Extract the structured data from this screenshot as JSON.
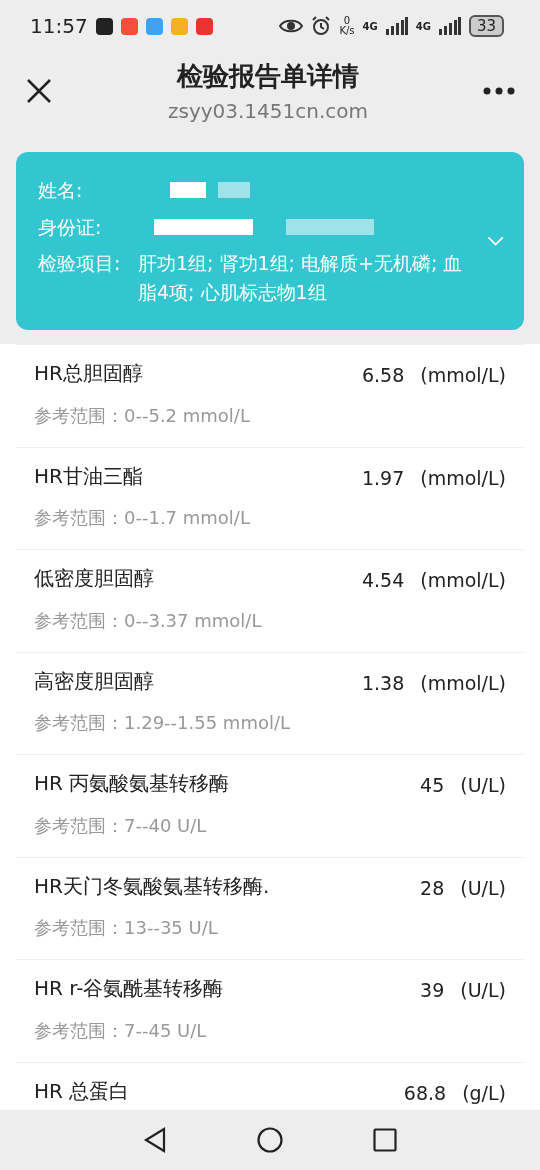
{
  "status_bar": {
    "time": "11:57",
    "net_speed_value": "0",
    "net_speed_unit": "K/s",
    "network_1": "4G",
    "network_2": "4G",
    "battery": "33"
  },
  "header": {
    "title": "检验报告单详情",
    "url": "zsyy03.1451cn.com"
  },
  "patient_card": {
    "expanded": false,
    "fields": [
      {
        "label": "姓名:",
        "kind": "redacted"
      },
      {
        "label": "身份证:",
        "kind": "redacted"
      },
      {
        "label": "检验项目:",
        "value": "肝功1组; 肾功1组; 电解质+无机磷; 血脂4项; 心肌标志物1组",
        "kind": "text"
      }
    ]
  },
  "results": [
    {
      "name": "HR总胆固醇",
      "value": "6.58",
      "unit": "(mmol/L)",
      "range": "参考范围：0--5.2 mmol/L"
    },
    {
      "name": "HR甘油三酯",
      "value": "1.97",
      "unit": "(mmol/L)",
      "range": "参考范围：0--1.7 mmol/L"
    },
    {
      "name": "低密度胆固醇",
      "value": "4.54",
      "unit": "(mmol/L)",
      "range": "参考范围：0--3.37 mmol/L"
    },
    {
      "name": "高密度胆固醇",
      "value": "1.38",
      "unit": "(mmol/L)",
      "range": "参考范围：1.29--1.55 mmol/L"
    },
    {
      "name": "HR 丙氨酸氨基转移酶",
      "value": "45",
      "unit": "(U/L)",
      "range": "参考范围：7--40 U/L"
    },
    {
      "name": "HR天门冬氨酸氨基转移酶.",
      "value": "28",
      "unit": "(U/L)",
      "range": "参考范围：13--35 U/L"
    },
    {
      "name": "HR r-谷氨酰基转移酶",
      "value": "39",
      "unit": "(U/L)",
      "range": "参考范围：7--45 U/L"
    },
    {
      "name": "HR 总蛋白",
      "value": "68.8",
      "unit": "(g/L)"
    }
  ]
}
